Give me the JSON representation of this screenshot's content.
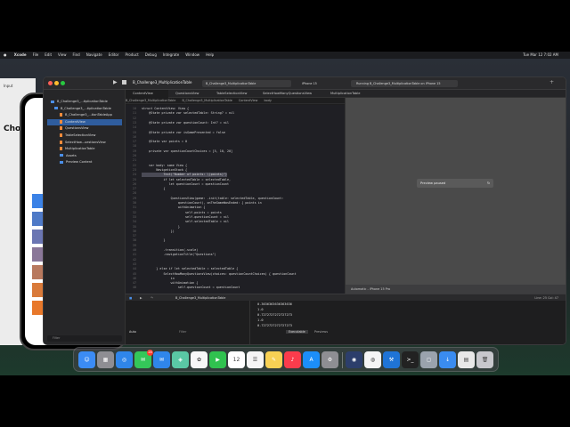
{
  "menubar": {
    "apple": "",
    "items": [
      "Xcode",
      "File",
      "Edit",
      "View",
      "Find",
      "Navigate",
      "Editor",
      "Product",
      "Debug",
      "Integrate",
      "Window",
      "Help"
    ],
    "clock": "Tue Mar 12  7:02 AM"
  },
  "simulator": {
    "back_label": "Input",
    "big_title": "Cho",
    "filter_placeholder": "Filter"
  },
  "xcode": {
    "scheme": "B_Challenge3_MultiplicationTable",
    "destination": "iPhone 15",
    "status": "Running B_Challenge3_MultiplicationTable on iPhone 15",
    "tabs": [
      "ContentView",
      "QuestionsView",
      "TableSelectionView",
      "SelectHowManyQuestionsView",
      "MultiplicationTable"
    ],
    "breadcrumb": [
      "B_Challenge3_MultiplicationTable",
      "B_Challenge3_MultiplicationTable",
      "ContentView",
      "body"
    ],
    "navigator": {
      "items": [
        {
          "label": "B_Challenge3_...tiplicationTable",
          "kind": "project"
        },
        {
          "label": "B_Challenge3_...tiplicationTable",
          "kind": "folder"
        },
        {
          "label": "B_Challenge3_...tionTableApp",
          "kind": "file"
        },
        {
          "label": "ContentView",
          "kind": "file",
          "selected": true
        },
        {
          "label": "QuestionsView",
          "kind": "file"
        },
        {
          "label": "TableSelectionView",
          "kind": "file"
        },
        {
          "label": "SelectHow...uestionsView",
          "kind": "file"
        },
        {
          "label": "MultiplicationTable",
          "kind": "file"
        },
        {
          "label": "Assets",
          "kind": "folder"
        },
        {
          "label": "Preview Content",
          "kind": "folder"
        }
      ],
      "filter": "Filter"
    },
    "code": {
      "line_numbers": [
        "10",
        "11",
        "12",
        "13",
        "14",
        "15",
        "16",
        "17",
        "18",
        "19",
        "20",
        "21",
        "22",
        "23",
        "24",
        "25",
        "26",
        "27",
        "28",
        "29",
        "30",
        "31",
        "32",
        "33",
        "34",
        "35",
        "36",
        "37",
        "38",
        "39",
        "40",
        "41",
        "42",
        "43",
        "44",
        "45",
        "46",
        "47",
        "48"
      ],
      "lines": [
        "struct ContentView: View {",
        "    @State private var selectedTable: String? = nil",
        "",
        "    @State private var questionCount: Int? = nil",
        "",
        "    @State private var isGamePresented = false",
        "",
        "    @State var points = 0",
        "",
        "    private var questionCountChoices = [5, 10, 20]",
        "",
        "",
        "    var body: some View {",
        "        NavigationStack {",
        "            Text(\"Number of points: \\(points)\")",
        "            if let selectedTable = selectedTable,",
        "               let questionCount = questionCount",
        "            {",
        "",
        "                QuestionsView(game: .init(table: selectedTable, questionCount:",
        "                    questionCount), onTheGameWasEnded: { points in",
        "                    withAnimation {",
        "                        self.points = points",
        "                        self.questionCount = nil",
        "                        self.selectedTable = nil",
        "                    }",
        "                })",
        "",
        "            }",
        "",
        "            .transition(.scale)",
        "            .navigationTitle(\"Questions\")",
        "",
        "",
        "        } else if let selectedTable = selectedTable {",
        "            SelectHowManyQuestionsView(choices: questionCountChoices) { questionCount",
        "                in",
        "                withAnimation {",
        "                    self.questionCount = questionCount"
      ]
    },
    "preview": {
      "paused_label": "Preview paused",
      "footer": "Automatic - iPhone 15 Pro"
    },
    "debug": {
      "target": "B_Challenge3_MultiplicationTable",
      "right": "Line: 25  Col: 47"
    },
    "console": {
      "left_label": "Auto",
      "filter": "Filter",
      "tabs": [
        "Executable",
        "Previews"
      ],
      "output": [
        "0.3636363636363636",
        "1.0",
        "0.7272727272727273",
        "1.0",
        "0.7272727272727273"
      ]
    }
  },
  "dock": {
    "icons": [
      {
        "name": "finder-icon",
        "color": "#3b8cf5",
        "glyph": "☺"
      },
      {
        "name": "launchpad-icon",
        "color": "#8e8e93",
        "glyph": "▦"
      },
      {
        "name": "safari-icon",
        "color": "#2f86ea",
        "glyph": "◎"
      },
      {
        "name": "messages-icon",
        "color": "#34c759",
        "glyph": "✉",
        "badge": "28"
      },
      {
        "name": "mail-icon",
        "color": "#2f86ea",
        "glyph": "✉"
      },
      {
        "name": "maps-icon",
        "color": "#5ac8a5",
        "glyph": "◈"
      },
      {
        "name": "photos-icon",
        "color": "#f7f7f7",
        "glyph": "✿"
      },
      {
        "name": "facetime-icon",
        "color": "#30c24f",
        "glyph": "▶"
      },
      {
        "name": "calendar-icon",
        "color": "#ffffff",
        "glyph": "12"
      },
      {
        "name": "reminders-icon",
        "color": "#f5f5f5",
        "glyph": "☰"
      },
      {
        "name": "notes-icon",
        "color": "#f7d154",
        "glyph": "✎"
      },
      {
        "name": "music-icon",
        "color": "#fa3c4c",
        "glyph": "♪"
      },
      {
        "name": "appstore-icon",
        "color": "#1c8ef9",
        "glyph": "A"
      },
      {
        "name": "settings-icon",
        "color": "#8e8e93",
        "glyph": "⚙"
      },
      {
        "name": "separator",
        "color": "transparent",
        "glyph": ""
      },
      {
        "name": "simulator-icon",
        "color": "#2c3e6b",
        "glyph": "◉"
      },
      {
        "name": "chrome-icon",
        "color": "#f5f5f5",
        "glyph": "◍"
      },
      {
        "name": "xcode-icon",
        "color": "#1f74d6",
        "glyph": "⚒"
      },
      {
        "name": "terminal-icon",
        "color": "#222222",
        "glyph": ">_"
      },
      {
        "name": "screenshot-icon",
        "color": "#9aa3ad",
        "glyph": "◻"
      },
      {
        "name": "downloads-icon",
        "color": "#3a8cf0",
        "glyph": "↓"
      },
      {
        "name": "document-icon",
        "color": "#e8e8e8",
        "glyph": "▤"
      },
      {
        "name": "trash-icon",
        "color": "#c7c7cc",
        "glyph": "🗑"
      }
    ]
  }
}
